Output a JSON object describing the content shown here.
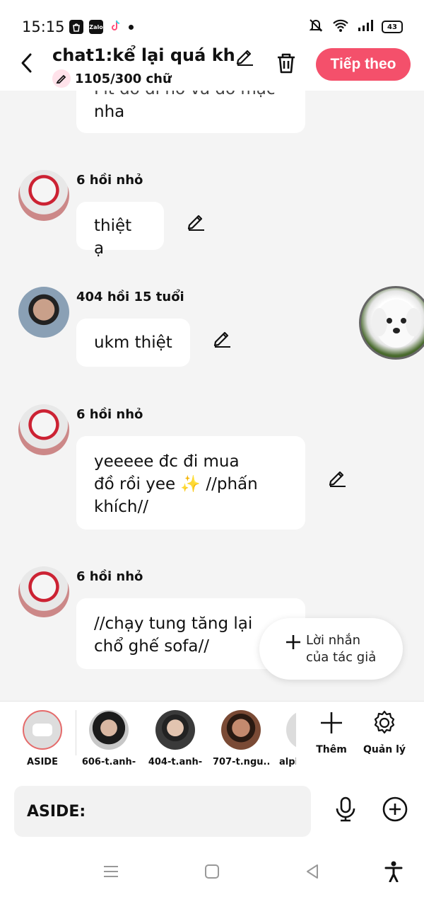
{
  "status_bar": {
    "time": "15:15",
    "zalo_label": "Zalo",
    "battery_level": "43"
  },
  "header": {
    "title": "chat1:kể lại quá kh...",
    "word_count": "1105/300 chữ",
    "next_label": "Tiếp theo"
  },
  "messages": [
    {
      "text": "nha",
      "partial_text": "Pit đó đi ho và đồ mặc"
    },
    {
      "sender": "6 hồi nhỏ",
      "text": "thiệt ạ"
    },
    {
      "sender": "404 hồi 15 tuổi",
      "text": "ukm thiệt"
    },
    {
      "sender": "6 hồi nhỏ",
      "line1": "yeeeee đc đi mua",
      "line2": "đồ rồi yee ✨ //phấn",
      "line3": "khích//"
    },
    {
      "sender": "6 hồi nhỏ",
      "line1": "//chạy tung tăng lại",
      "line2": "chổ ghế sofa//"
    }
  ],
  "author_note": {
    "line1": "Lời nhắn",
    "line2": "của tác giả"
  },
  "characters": [
    {
      "name": "ASIDE"
    },
    {
      "name": "606-t.anh-"
    },
    {
      "name": "404-t.anh-"
    },
    {
      "name": "707-t.ngu..."
    },
    {
      "name": "alpi"
    }
  ],
  "tools": {
    "add_label": "Thêm",
    "manage_label": "Quản lý"
  },
  "input": {
    "value": "ASIDE:"
  },
  "colors": {
    "accent": "#f4506b",
    "background": "#f4f4f4",
    "bubble": "#ffffff"
  }
}
